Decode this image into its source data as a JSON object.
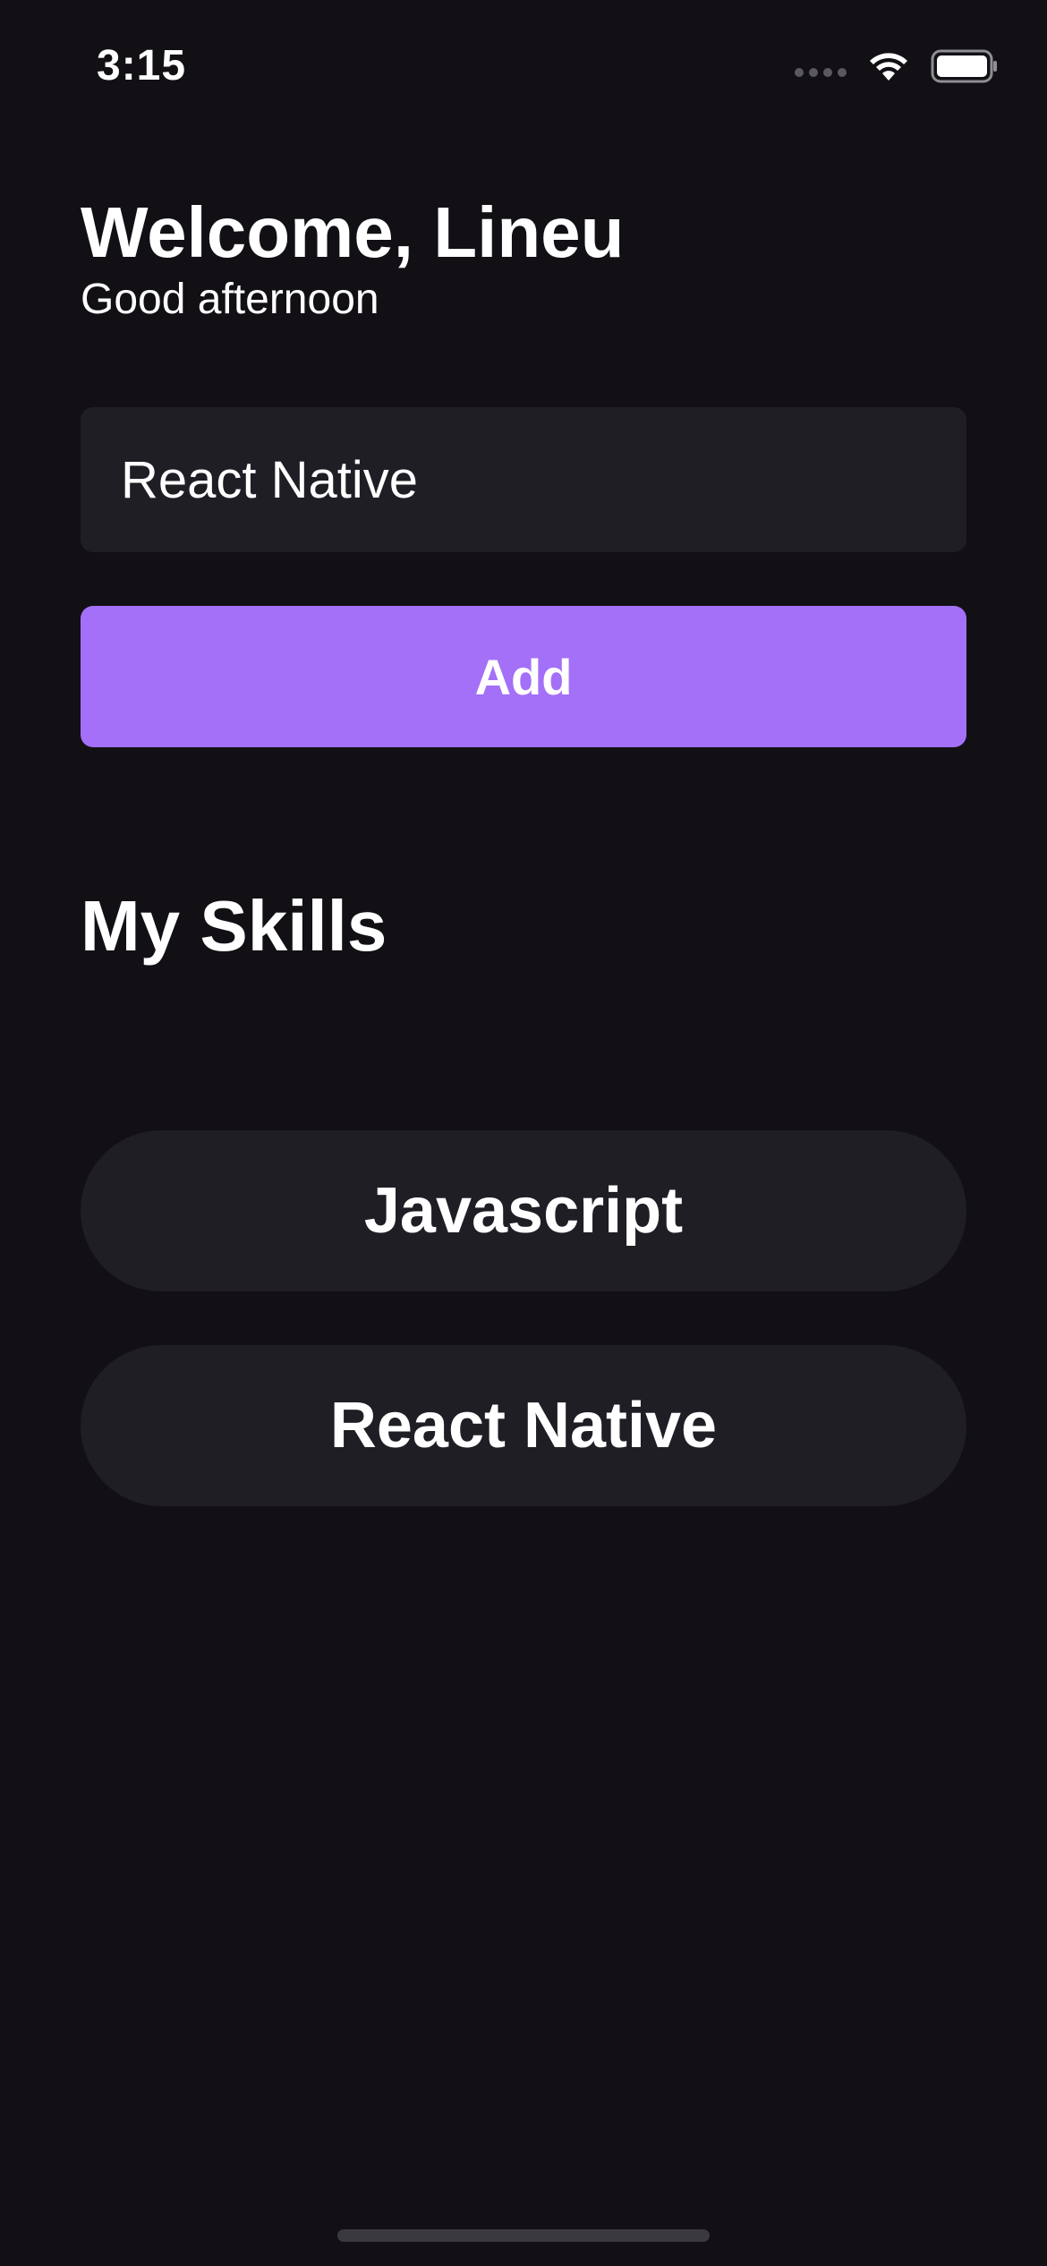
{
  "status_bar": {
    "time": "3:15",
    "icons": [
      "cellular-signal-icon",
      "wifi-icon",
      "battery-icon"
    ]
  },
  "header": {
    "welcome": "Welcome, Lineu",
    "greeting": "Good afternoon"
  },
  "form": {
    "input_value": "React Native",
    "add_label": "Add"
  },
  "skills": {
    "title": "My Skills",
    "items": [
      {
        "label": "Javascript"
      },
      {
        "label": "React Native"
      }
    ]
  },
  "colors": {
    "background": "#121015",
    "surface": "#1f1e25",
    "accent": "#a370f7",
    "text": "#ffffff"
  }
}
